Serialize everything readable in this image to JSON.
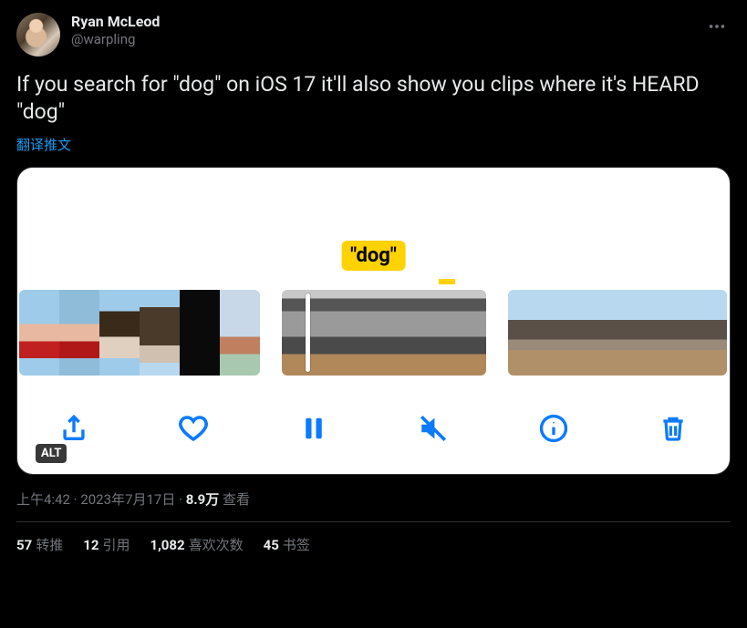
{
  "author": {
    "display_name": "Ryan McLeod",
    "handle": "@warpling"
  },
  "tweet": {
    "text": "If you search for \"dog\" on iOS 17 it'll also show you clips where it's HEARD \"dog\"",
    "translate_label": "翻译推文"
  },
  "media": {
    "search_label": "\"dog\"",
    "alt_badge": "ALT"
  },
  "meta": {
    "time": "上午4:42",
    "separator": " · ",
    "date": "2023年7月17日",
    "views_count": "8.9万",
    "views_label": " 查看"
  },
  "stats": {
    "retweets": {
      "count": "57",
      "label": "转推"
    },
    "quotes": {
      "count": "12",
      "label": "引用"
    },
    "likes": {
      "count": "1,082",
      "label": "喜欢次数"
    },
    "bookmarks": {
      "count": "45",
      "label": "书签"
    }
  }
}
